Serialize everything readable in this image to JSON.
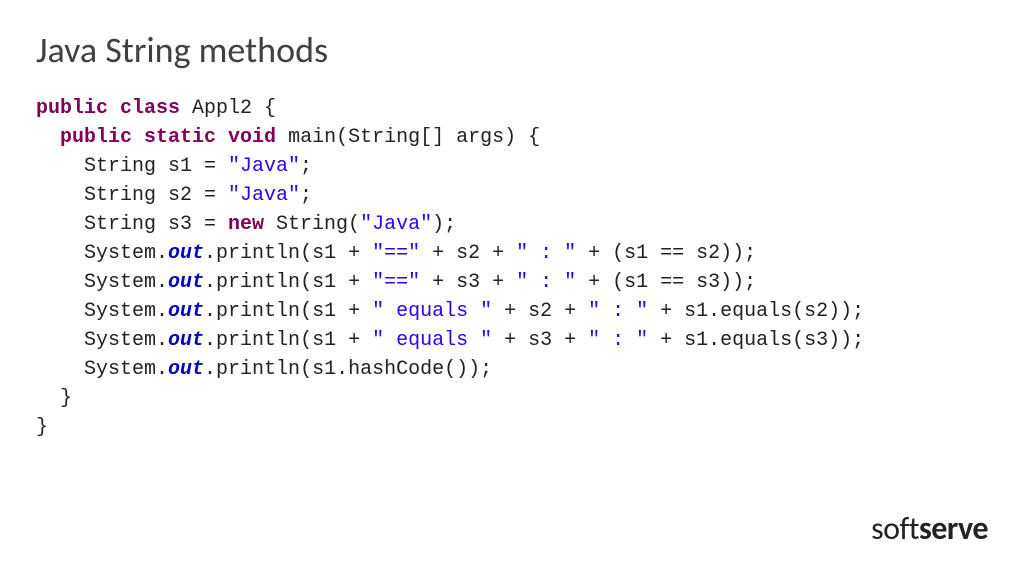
{
  "title": "Java String methods",
  "code": {
    "l1_kw": "public class",
    "l1_cls": " Appl2 {",
    "l2_ind": "  ",
    "l2_kw": "public static void",
    "l2_m": " main(String[] args) {",
    "l3": "    String s1 = ",
    "l3_s": "\"Java\"",
    "l3_e": ";",
    "l4": "    String s2 = ",
    "l4_s": "\"Java\"",
    "l4_e": ";",
    "l5a": "    String s3 = ",
    "l5_kw": "new",
    "l5b": " String(",
    "l5_s": "\"Java\"",
    "l5c": ");",
    "l6a": "    System.",
    "l6f": "out",
    "l6b": ".println(s1 + ",
    "l6s1": "\"==\"",
    "l6c": " + s2 + ",
    "l6s2": "\" : \"",
    "l6d": " + (s1 == s2));",
    "l7a": "    System.",
    "l7f": "out",
    "l7b": ".println(s1 + ",
    "l7s1": "\"==\"",
    "l7c": " + s3 + ",
    "l7s2": "\" : \"",
    "l7d": " + (s1 == s3));",
    "l8a": "    System.",
    "l8f": "out",
    "l8b": ".println(s1 + ",
    "l8s1": "\" equals \"",
    "l8c": " + s2 + ",
    "l8s2": "\" : \"",
    "l8d": " + s1.equals(s2));",
    "l9a": "    System.",
    "l9f": "out",
    "l9b": ".println(s1 + ",
    "l9s1": "\" equals \"",
    "l9c": " + s3 + ",
    "l9s2": "\" : \"",
    "l9d": " + s1.equals(s3));",
    "l10a": "    System.",
    "l10f": "out",
    "l10b": ".println(s1.hashCode());",
    "l11": "  }",
    "l12": "}"
  },
  "logo": {
    "a": "soft",
    "b": "serve"
  }
}
